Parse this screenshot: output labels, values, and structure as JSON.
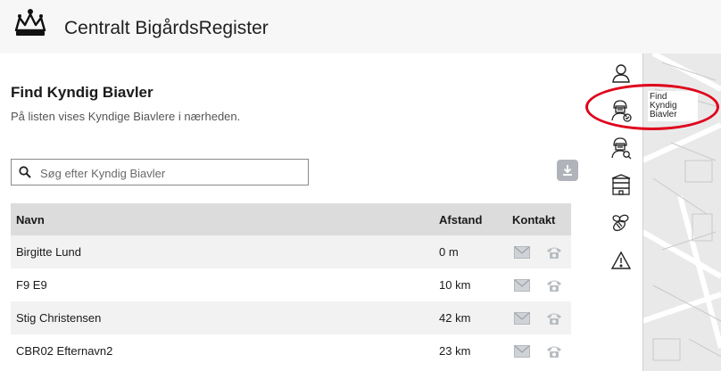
{
  "app": {
    "title": "Centralt BigårdsRegister"
  },
  "page": {
    "title": "Find Kyndig Biavler",
    "subtitle": "På listen vises Kyndige Biavlere i nærheden."
  },
  "search": {
    "placeholder": "Søg efter Kyndig Biavler",
    "value": ""
  },
  "table": {
    "headers": {
      "name": "Navn",
      "distance": "Afstand",
      "contact": "Kontakt"
    },
    "rows": [
      {
        "name": "Birgitte Lund",
        "distance": "0 m"
      },
      {
        "name": "F9 E9",
        "distance": "10 km"
      },
      {
        "name": "Stig Christensen",
        "distance": "42 km"
      },
      {
        "name": "CBR02 Efternavn2",
        "distance": "23 km"
      }
    ]
  },
  "rail": {
    "items": [
      {
        "icon": "user-icon"
      },
      {
        "icon": "beekeeper-icon",
        "label": "Find Kyndig Biavler"
      },
      {
        "icon": "beekeeper-search-icon"
      },
      {
        "icon": "beehive-icon"
      },
      {
        "icon": "bee-icon"
      },
      {
        "icon": "warning-icon"
      }
    ],
    "tooltip": "Find Kyndig Biavler"
  },
  "colors": {
    "highlight": "#e0001b",
    "header_bg": "#f7f7f7",
    "table_header": "#dcdcdc"
  }
}
